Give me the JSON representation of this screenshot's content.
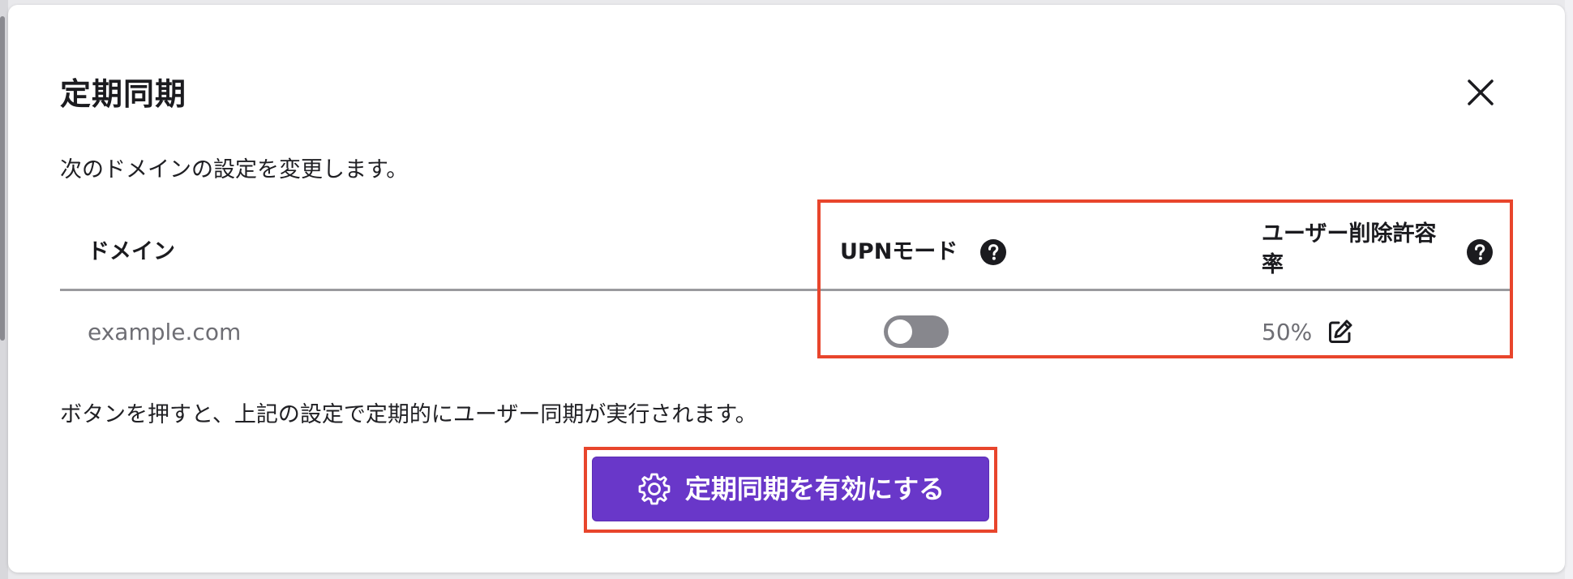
{
  "dialog": {
    "title": "定期同期",
    "description": "次のドメインの設定を変更します。",
    "note": "ボタンを押すと、上記の設定で定期的にユーザー同期が実行されます。"
  },
  "table": {
    "headers": {
      "domain": "ドメイン",
      "upn_mode": "UPNモード",
      "deletion_tolerance": "ユーザー削除許容率"
    },
    "rows": [
      {
        "domain": "example.com",
        "upn_mode_enabled": false,
        "deletion_tolerance": "50%"
      }
    ]
  },
  "actions": {
    "enable_button_label": "定期同期を有効にする"
  },
  "icons": {
    "close": "close-icon",
    "help": "help-icon",
    "edit": "edit-icon",
    "gear": "gear-icon"
  },
  "colors": {
    "primary": "#6937c9",
    "highlight": "#e8452c",
    "toggle_off": "#87878d",
    "text_muted": "#6e6e74"
  }
}
